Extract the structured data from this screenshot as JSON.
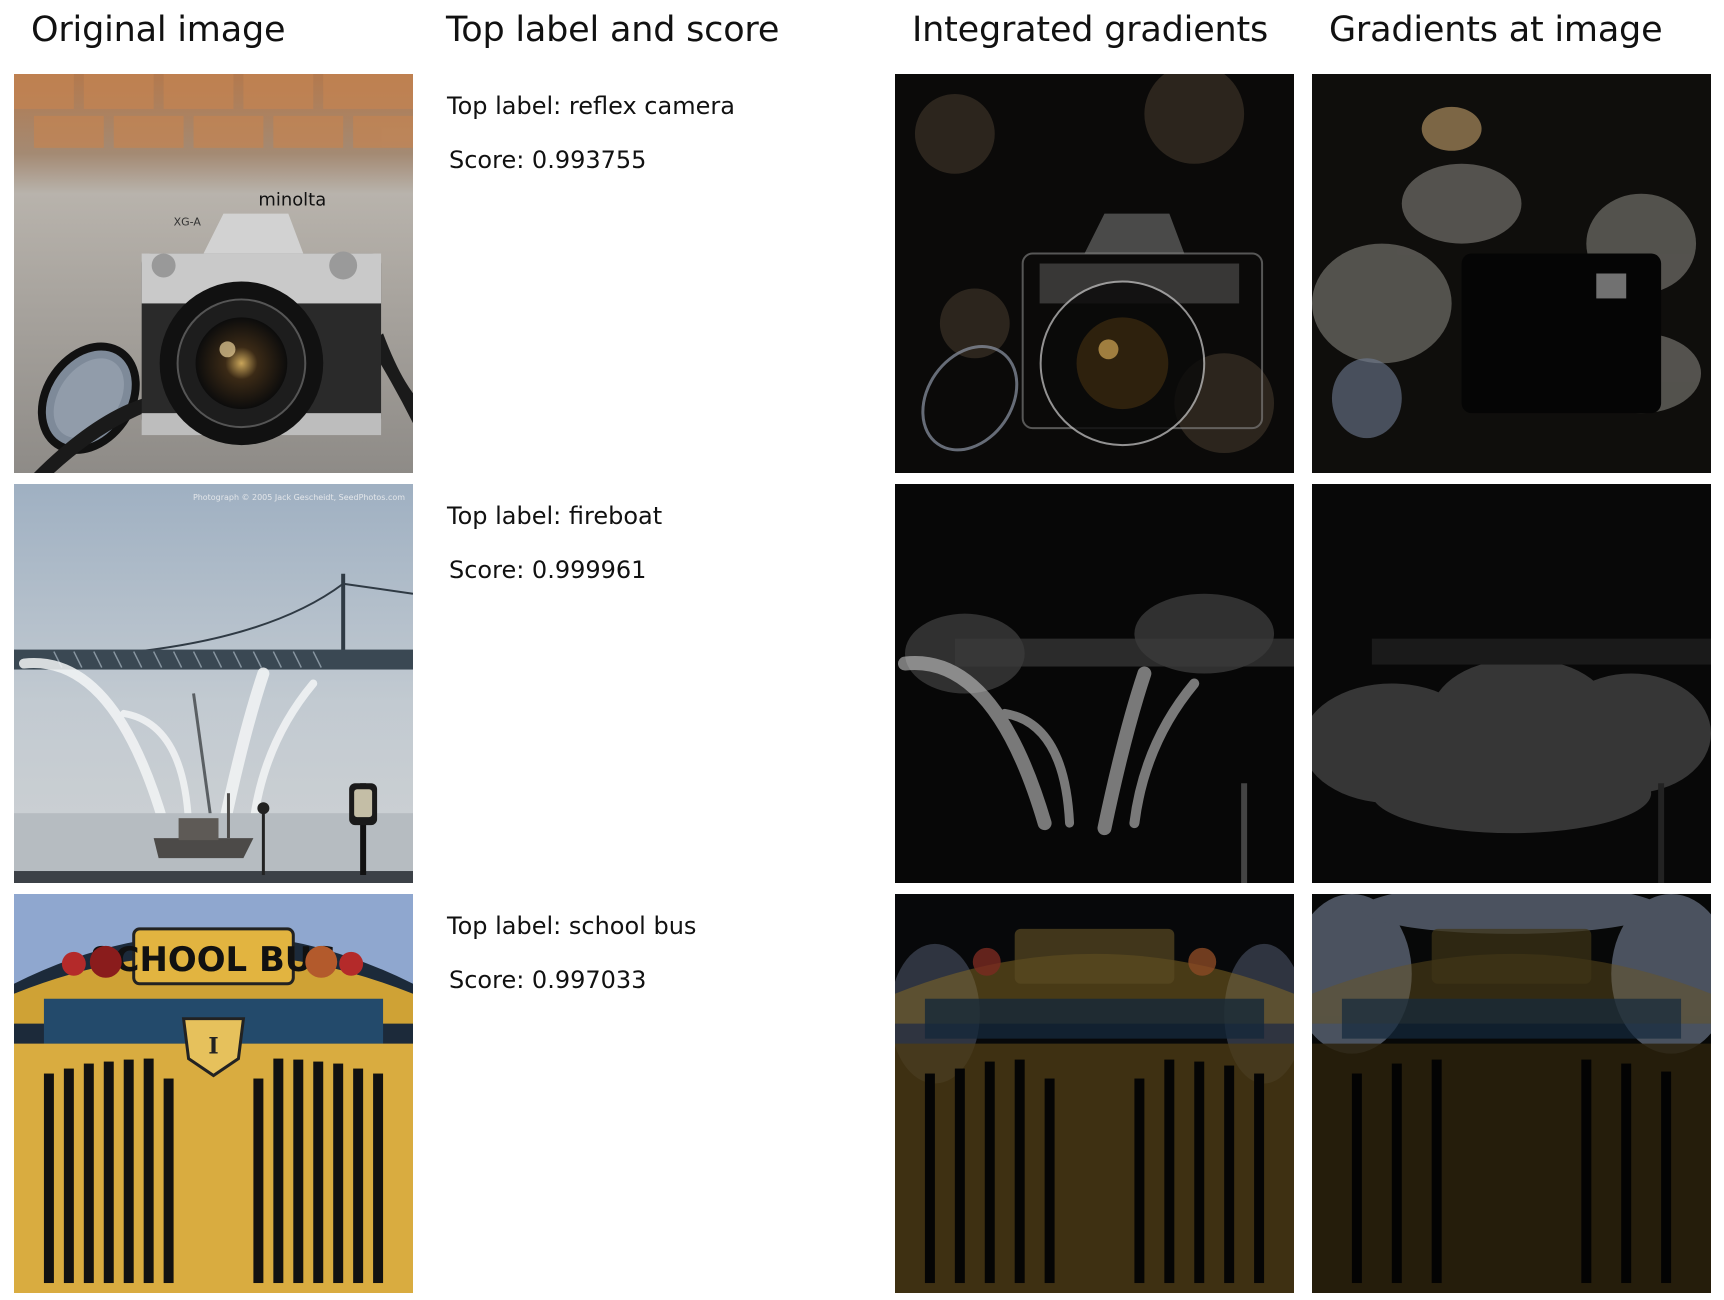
{
  "columns": [
    "Original image",
    "Top label and score",
    "Integrated gradients",
    "Gradients at image"
  ],
  "rows": [
    {
      "subject": "reflex camera",
      "top_label": "Top label: reflex camera",
      "score": "Score: 0.993755",
      "camera_brand": "minolta",
      "model": "XG-A"
    },
    {
      "subject": "fireboat",
      "top_label": "Top label: fireboat",
      "score": "Score: 0.999961",
      "watermark": "Photograph © 2005 Jack Gescheidt, SeedPhotos.com"
    },
    {
      "subject": "school bus",
      "top_label": "Top label: school bus",
      "score": "Score: 0.997033",
      "sign": "SCHOOL BUS",
      "emblem": "I"
    }
  ]
}
